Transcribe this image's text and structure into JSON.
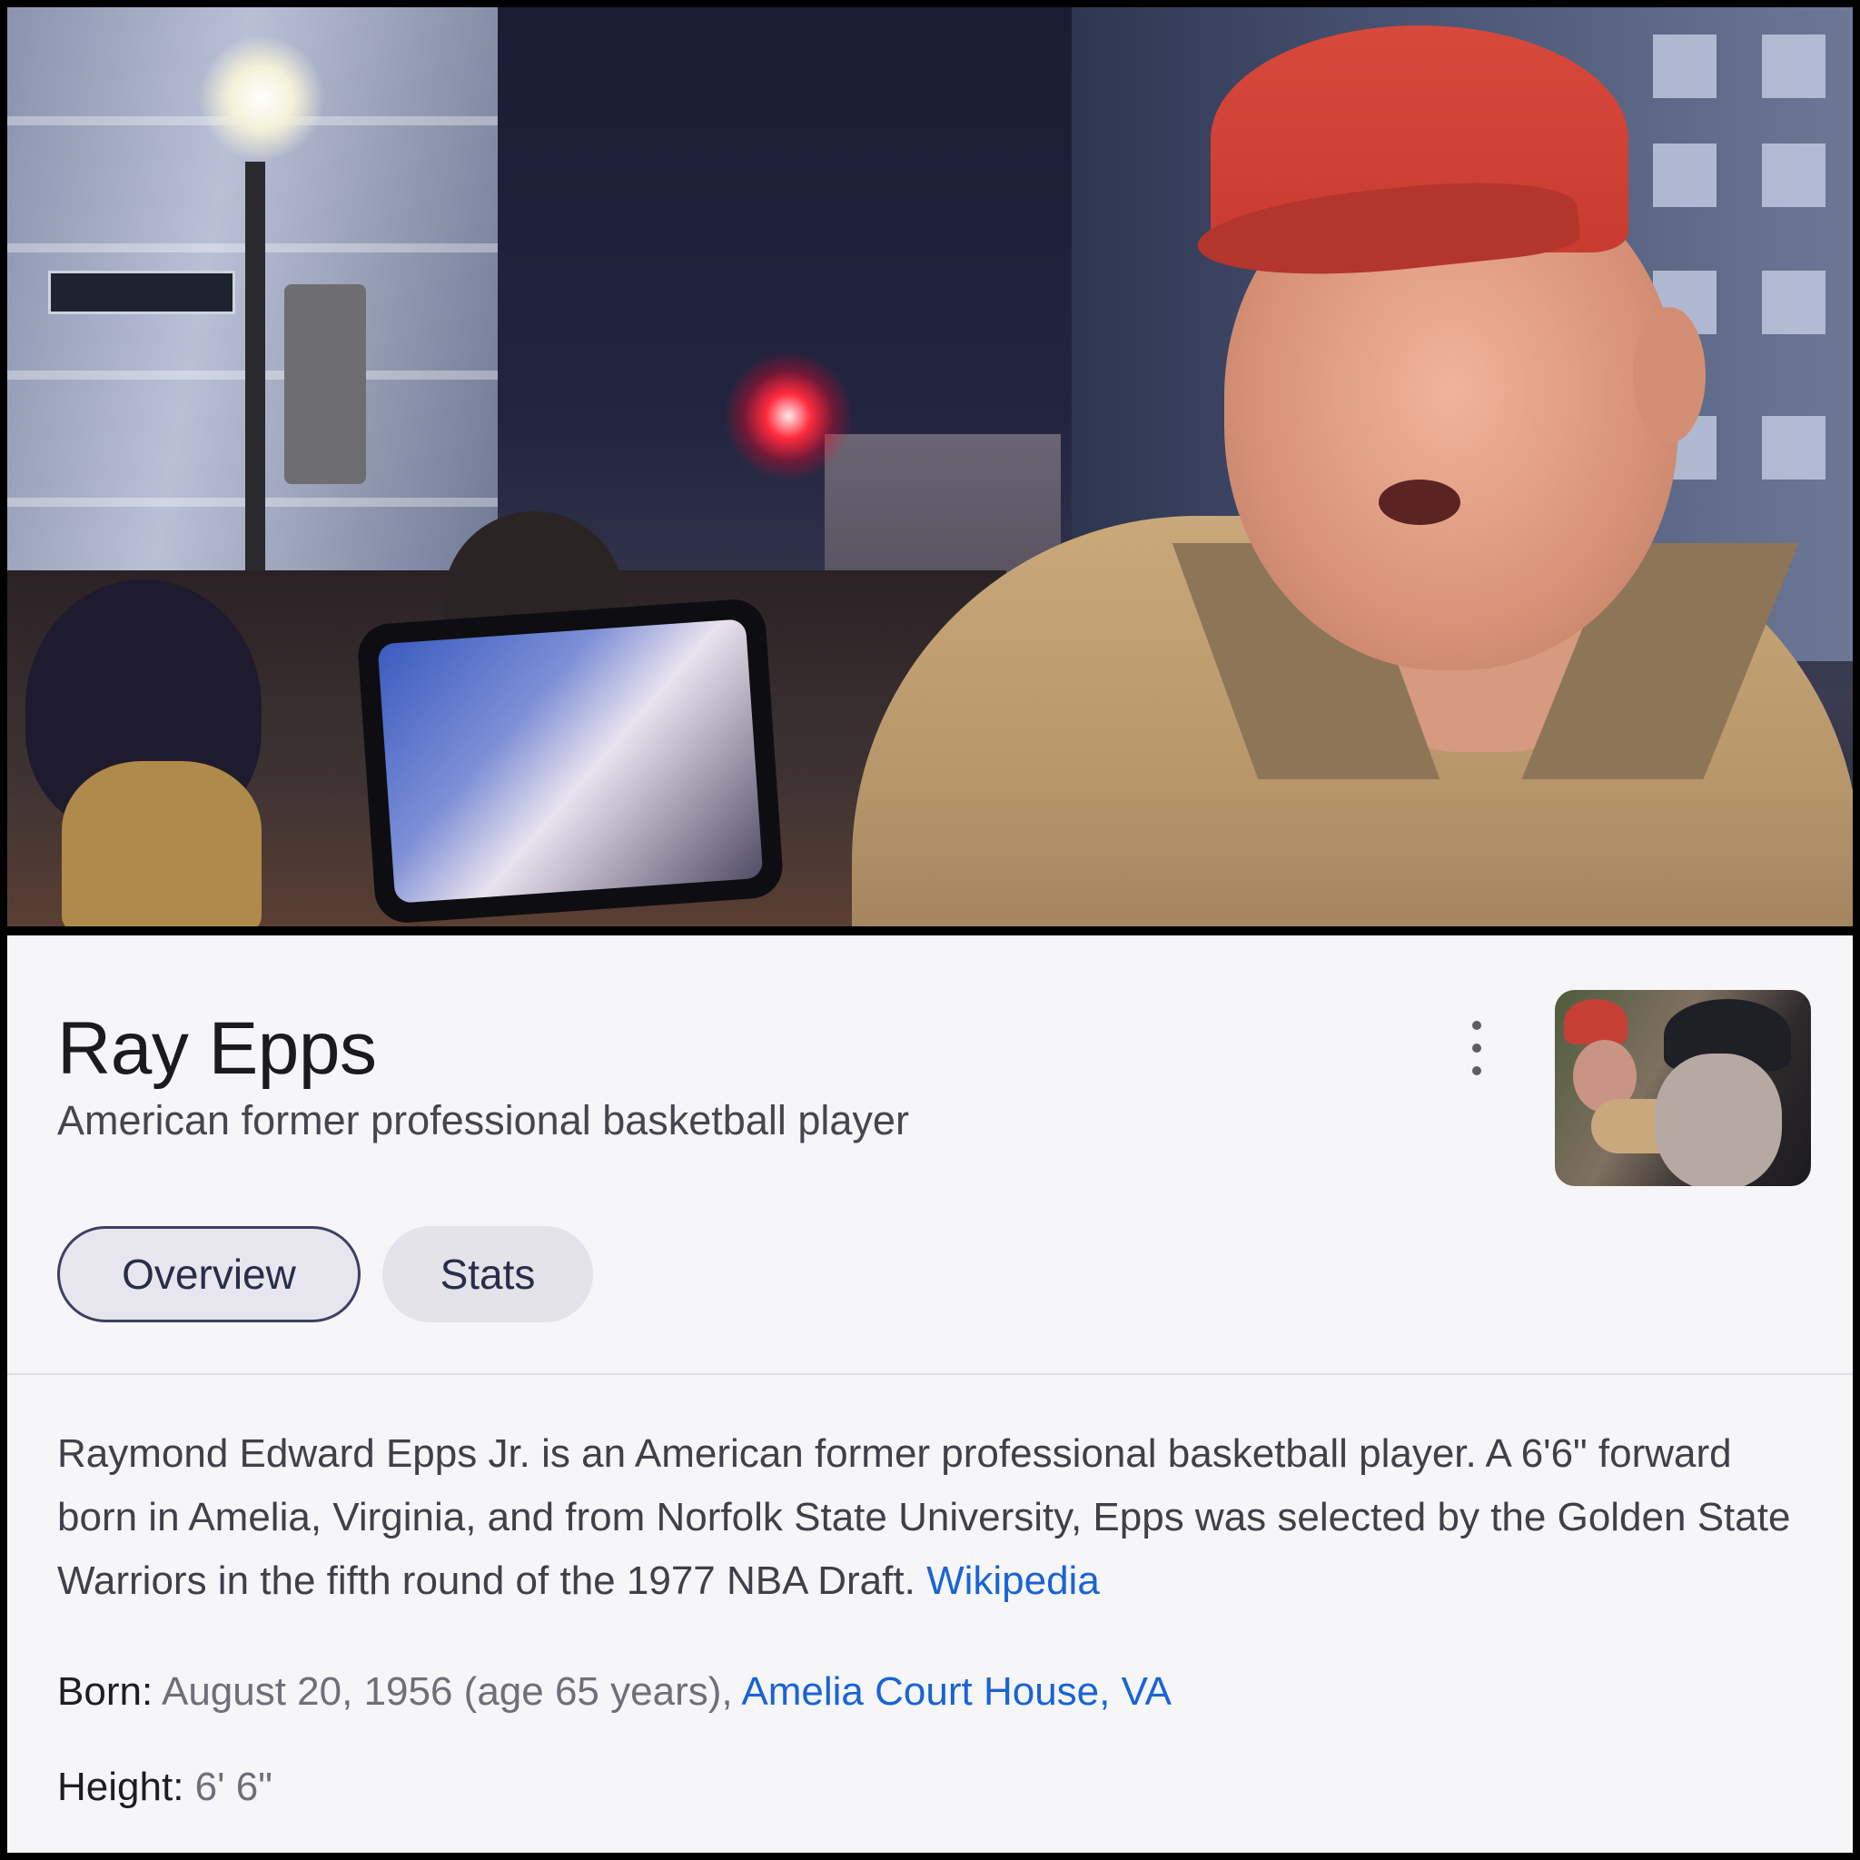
{
  "panel": {
    "title": "Ray Epps",
    "subtitle": "American former professional basketball player",
    "tabs": [
      {
        "label": "Overview",
        "active": true
      },
      {
        "label": "Stats",
        "active": false
      }
    ],
    "description": {
      "text": "Raymond Edward Epps Jr. is an American former professional basketball player. A 6'6\" forward born in Amelia, Virginia, and from Norfolk State University, Epps was selected by the Golden State Warriors in the fifth round of the 1977 NBA Draft.",
      "source_link": "Wikipedia"
    },
    "facts": {
      "born": {
        "label": "Born:",
        "value": "August 20, 1956 (age 65 years),",
        "place_link": "Amelia Court House, VA"
      },
      "height": {
        "label": "Height:",
        "value": "6' 6\""
      }
    }
  },
  "colors": {
    "link": "#1a63d4",
    "panel_background": "#f6f6f8",
    "active_tab_border": "#3d3f66",
    "cap_red": "#c93b30"
  }
}
